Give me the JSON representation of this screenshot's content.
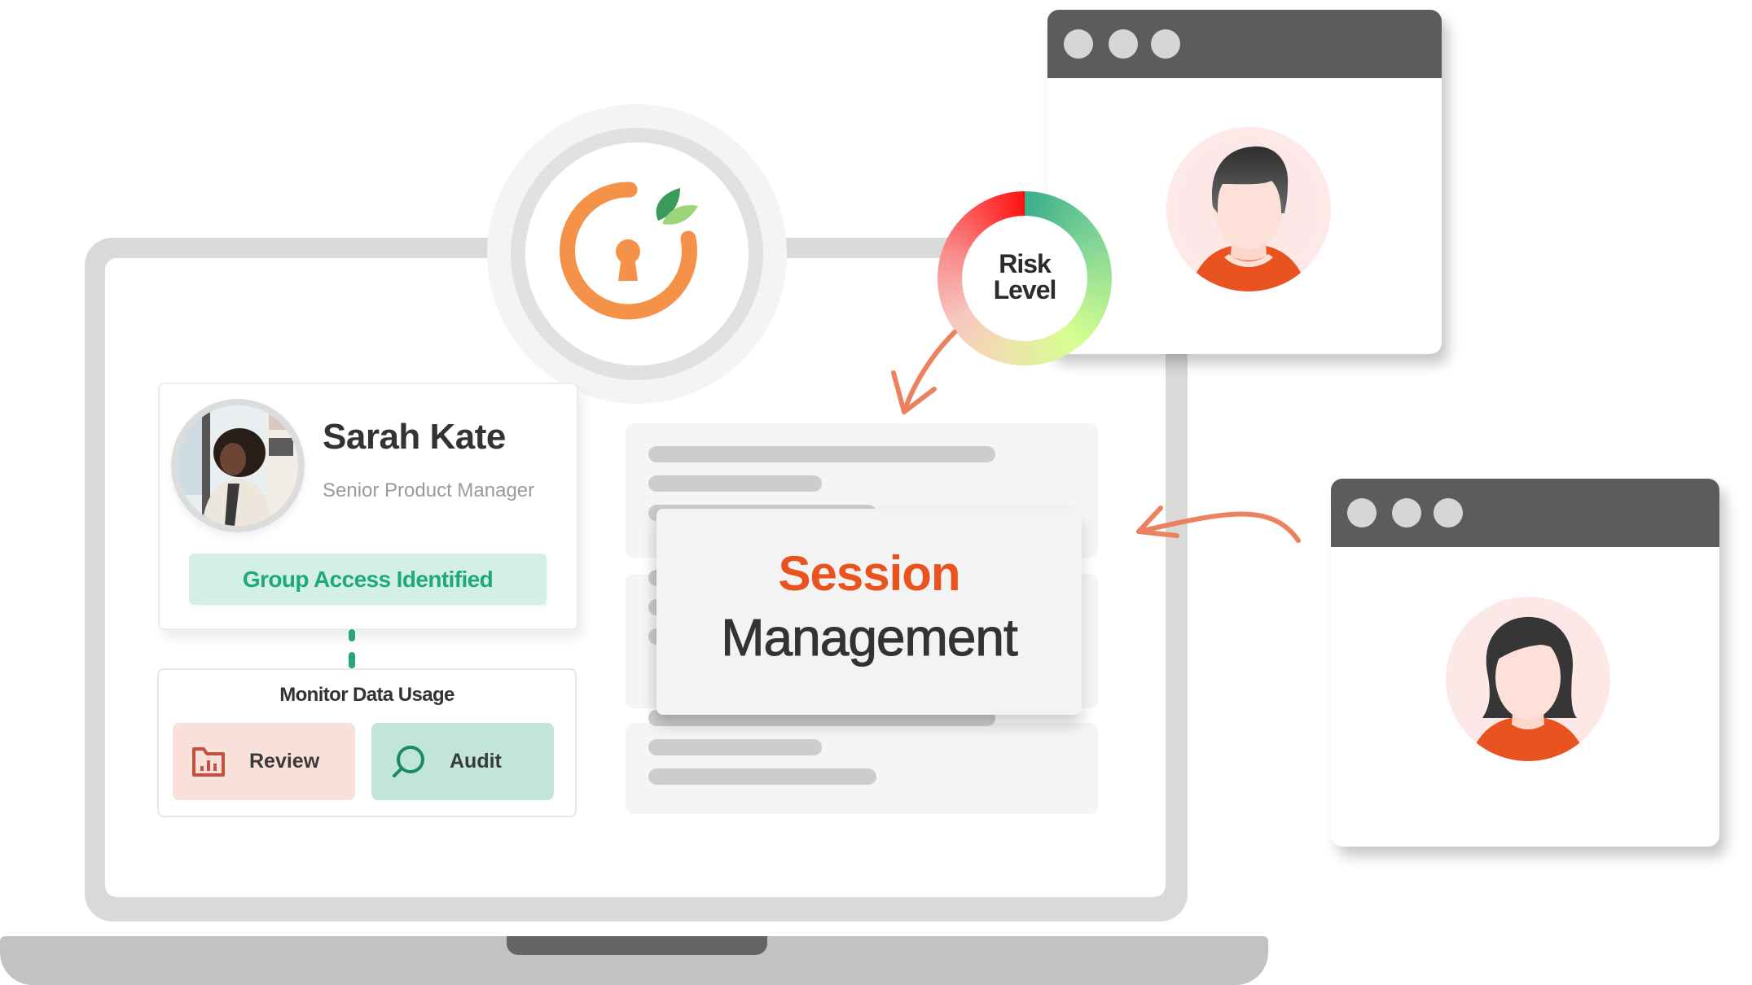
{
  "logo": {
    "icon": "keyhole-leaf-logo",
    "colors": {
      "ring": "#f4924a",
      "leaf_dark": "#3a9a5a",
      "leaf_light": "#9bd57c"
    }
  },
  "profile": {
    "name": "Sarah Kate",
    "role": "Senior Product Manager",
    "badge": "Group Access Identified",
    "colors": {
      "badge_bg": "#d3efe6",
      "badge_text": "#1daa78"
    }
  },
  "monitor": {
    "title": "Monitor Data Usage",
    "buttons": [
      {
        "label": "Review",
        "icon": "folder-chart-icon",
        "bg": "#f9e0da",
        "icon_color": "#c4513f"
      },
      {
        "label": "Audit",
        "icon": "search-icon",
        "bg": "#c2e5da",
        "icon_color": "#1b8a60"
      }
    ]
  },
  "session": {
    "title": "Session",
    "subtitle": "Management",
    "title_color": "#e9531e"
  },
  "risk": {
    "label_line1": "Risk",
    "label_line2": "Level"
  },
  "windows": [
    {
      "user": "male-user-avatar"
    },
    {
      "user": "female-user-avatar"
    }
  ],
  "accent": {
    "arrow": "#ec8160",
    "connector": "#27a57a"
  }
}
